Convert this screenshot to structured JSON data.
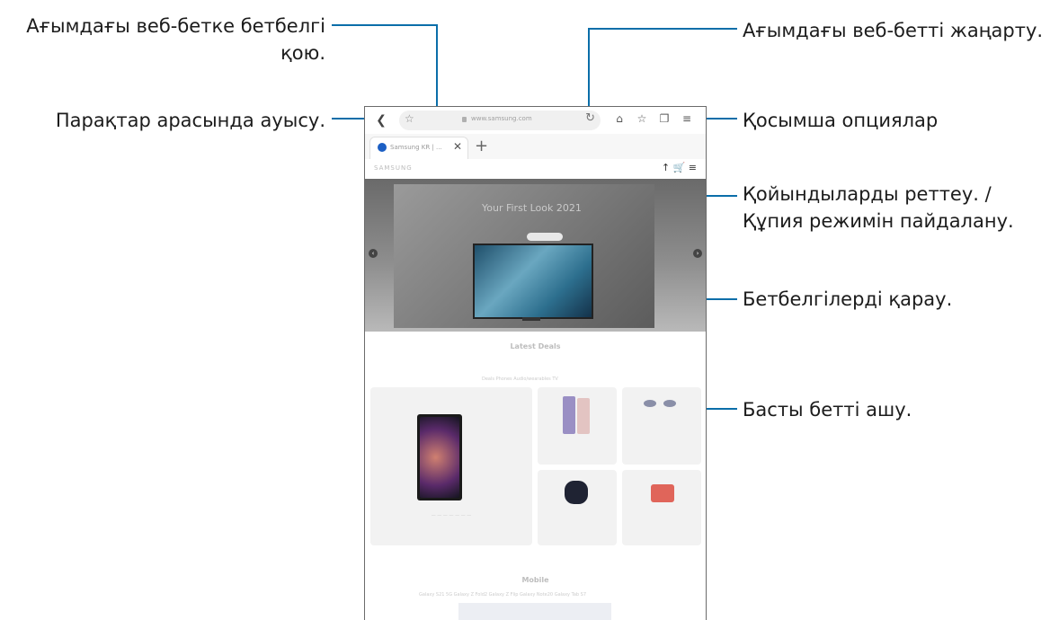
{
  "callouts": {
    "bookmark_add_line1": "Ағымдағы веб-бетке бетбелгі",
    "bookmark_add_line2": "қою.",
    "navigate": "Парақтар арасында ауысу.",
    "refresh": "Ағымдағы веб-бетті жаңарту.",
    "more_options": "Қосымша опциялар",
    "tabs_line1": "Қойындыларды реттеу. /",
    "tabs_line2": "Құпия режимін пайдалану.",
    "view_bookmarks": "Бетбелгілерді қарау.",
    "open_home": "Басты бетті ашу."
  },
  "browser": {
    "url": "www.samsung.com",
    "tab_title": "Samsung KR | ...",
    "icons": {
      "back": "chevron-left-icon",
      "forward": "chevron-right-icon",
      "bookmark_add": "star-outline-icon",
      "refresh": "refresh-icon",
      "home": "home-icon",
      "bookmarks": "star-icon",
      "tabs": "tabs-icon",
      "menu": "menu-icon"
    }
  },
  "website": {
    "logo": "SAMSUNG",
    "hero_text": "Your First Look 2021",
    "deals_title": "Latest Deals",
    "filters": "Deals   Phones   Audio/wearables   TV",
    "mobile_title": "Mobile",
    "mobile_tabs": "Galaxy S21 5G    Galaxy Z Fold2    Galaxy Z Flip    Galaxy Note20    Galaxy Tab S7"
  },
  "colors": {
    "accent": "#0b6ea9"
  }
}
